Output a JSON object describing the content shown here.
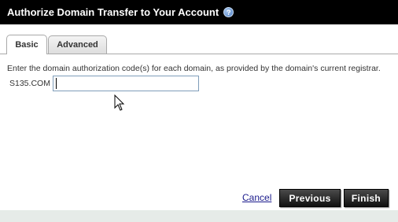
{
  "dialog": {
    "title": "Authorize Domain Transfer to Your Account",
    "help_icon": "question-circle-icon"
  },
  "tabs": [
    {
      "label": "Basic",
      "active": true
    },
    {
      "label": "Advanced",
      "active": false
    }
  ],
  "form": {
    "instructions": "Enter the domain authorization code(s) for each domain, as provided by the domain's current registrar.",
    "domain_label": "S135.COM",
    "auth_code_value": ""
  },
  "actions": {
    "cancel_label": "Cancel",
    "previous_label": "Previous",
    "finish_label": "Finish"
  },
  "colors": {
    "titlebar_bg": "#000000",
    "button_bg": "#222222",
    "link": "#1a1a8c",
    "footer_bg": "#e6ebe8"
  }
}
